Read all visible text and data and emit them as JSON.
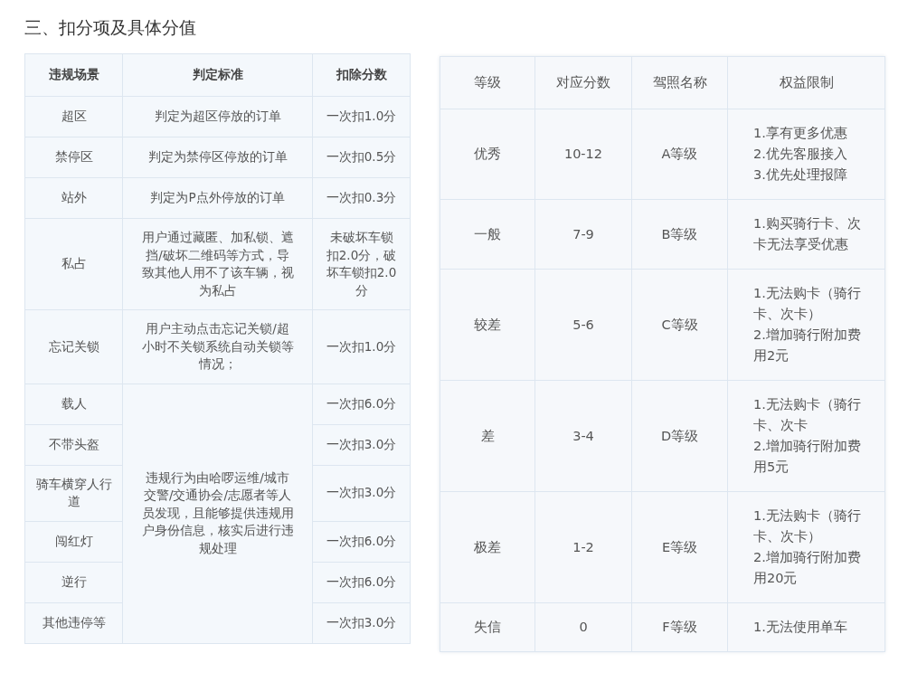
{
  "heading": "三、扣分项及具体分值",
  "penalty_table": {
    "columns": [
      "违规场景",
      "判定标准",
      "扣除分数"
    ],
    "rows": [
      {
        "scene": "超区",
        "criteria": "判定为超区停放的订单",
        "deduction": "一次扣1.0分"
      },
      {
        "scene": "禁停区",
        "criteria": "判定为禁停区停放的订单",
        "deduction": "一次扣0.5分"
      },
      {
        "scene": "站外",
        "criteria": "判定为P点外停放的订单",
        "deduction": "一次扣0.3分"
      },
      {
        "scene": "私占",
        "criteria": "用户通过藏匿、加私锁、遮挡/破坏二维码等方式，导致其他人用不了该车辆，视为私占",
        "deduction": "未破坏车锁扣2.0分，破坏车锁扣2.0分"
      },
      {
        "scene": "忘记关锁",
        "criteria": "用户主动点击忘记关锁/超小时不关锁系统自动关锁等情况；",
        "deduction": "一次扣1.0分"
      },
      {
        "scene": "载人",
        "deduction": "一次扣6.0分"
      },
      {
        "scene": "不带头盔",
        "deduction": "一次扣3.0分"
      },
      {
        "scene": "骑车横穿人行道",
        "deduction": "一次扣3.0分"
      },
      {
        "scene": "闯红灯",
        "deduction": "一次扣6.0分"
      },
      {
        "scene": "逆行",
        "deduction": "一次扣6.0分"
      },
      {
        "scene": "其他违停等",
        "deduction": "一次扣3.0分"
      }
    ],
    "shared_criteria": "违规行为由哈啰运维/城市交警/交通协会/志愿者等人员发现，且能够提供违规用户身份信息，核实后进行违规处理"
  },
  "level_table": {
    "columns": [
      "等级",
      "对应分数",
      "驾照名称",
      "权益限制"
    ],
    "rows": [
      {
        "grade": "优秀",
        "score": "10-12",
        "license": "A等级",
        "benefits": [
          "1.享有更多优惠",
          "2.优先客服接入",
          "3.优先处理报障"
        ]
      },
      {
        "grade": "一般",
        "score": "7-9",
        "license": "B等级",
        "benefits": [
          "1.购买骑行卡、次卡无法享受优惠"
        ]
      },
      {
        "grade": "较差",
        "score": "5-6",
        "license": "C等级",
        "benefits": [
          "1.无法购卡（骑行卡、次卡）",
          "2.增加骑行附加费用2元"
        ]
      },
      {
        "grade": "差",
        "score": "3-4",
        "license": "D等级",
        "benefits": [
          "1.无法购卡（骑行卡、次卡",
          "2.增加骑行附加费用5元"
        ]
      },
      {
        "grade": "极差",
        "score": "1-2",
        "license": "E等级",
        "benefits": [
          "1.无法购卡（骑行卡、次卡）",
          "2.增加骑行附加费用20元"
        ]
      },
      {
        "grade": "失信",
        "score": "0",
        "license": "F等级",
        "benefits": [
          "1.无法使用单车"
        ]
      }
    ]
  }
}
